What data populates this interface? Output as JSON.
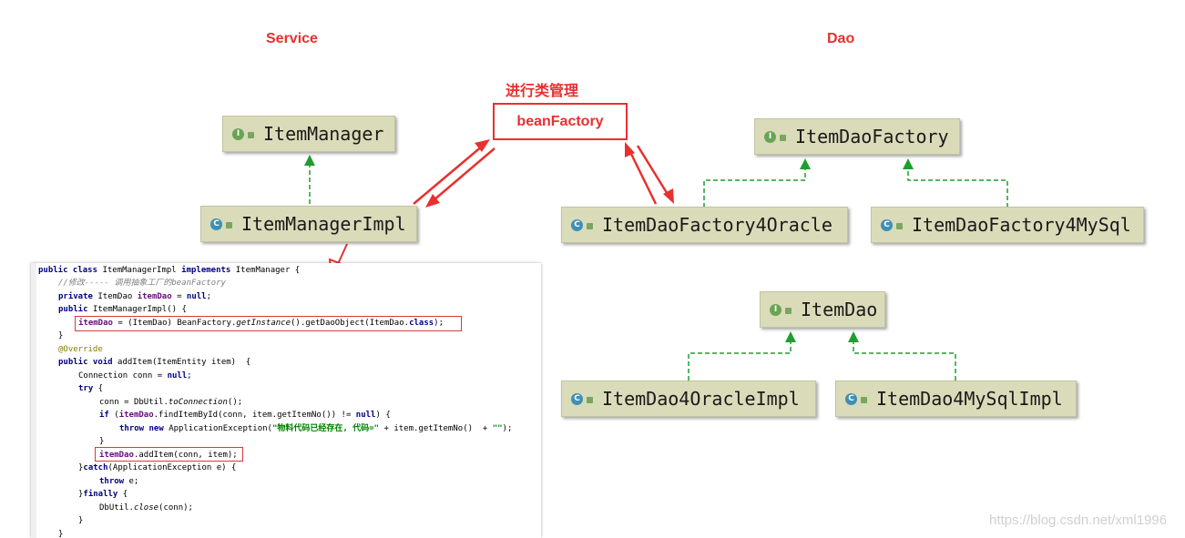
{
  "labels": {
    "service": "Service",
    "dao": "Dao",
    "manage": "进行类管理",
    "bean_factory": "beanFactory"
  },
  "classes": {
    "item_manager": "ItemManager",
    "item_manager_impl": "ItemManagerImpl",
    "item_dao_factory": "ItemDaoFactory",
    "item_dao_factory_oracle": "ItemDaoFactory4Oracle",
    "item_dao_factory_mysql": "ItemDaoFactory4MySql",
    "item_dao": "ItemDao",
    "item_dao_oracle_impl": "ItemDao4OracleImpl",
    "item_dao_mysql_impl": "ItemDao4MySqlImpl"
  },
  "badges": {
    "interface": "I",
    "class": "C"
  },
  "code": {
    "l1": [
      "public class ",
      "ItemManagerImpl ",
      "implements ",
      "ItemManager {"
    ],
    "l2": "//修改----- 调用抽象工厂的beanFactory",
    "l3": [
      "private ",
      "ItemDao ",
      "itemDao",
      " = ",
      "null",
      ";"
    ],
    "l4": [
      "public ",
      "ItemManagerImpl() {"
    ],
    "l5": [
      "itemDao",
      " = (ItemDao) BeanFactory.",
      "getInstance",
      "().getDaoObject(ItemDao.",
      "class",
      ");"
    ],
    "l6": "}",
    "l7": "@Override",
    "l8": [
      "public void ",
      "addItem(ItemEntity item)  {"
    ],
    "l9": [
      "Connection ",
      "conn",
      " = ",
      "null",
      ";"
    ],
    "l10": [
      "try",
      " {"
    ],
    "l11": [
      "conn",
      " = DbUtil.",
      "toConnection",
      "();"
    ],
    "l12": [
      "if ",
      "(",
      "itemDao",
      ".findItemById(conn, item.getItemNo()) != ",
      "null",
      ") {"
    ],
    "l13": [
      "throw new ",
      "ApplicationException(",
      "\"物料代码已经存在, 代码=\"",
      " + item.getItemNo()  + ",
      "\"\"",
      ");"
    ],
    "l14": "}",
    "l15": [
      "itemDao",
      ".addItem(conn, item);"
    ],
    "l16": [
      "}",
      "catch",
      "(ApplicationException ",
      "e",
      ") {"
    ],
    "l17": [
      "throw ",
      "e;"
    ],
    "l18": [
      "}",
      "finally",
      " {"
    ],
    "l19": [
      "DbUtil.",
      "close",
      "(conn);"
    ],
    "l20": "}",
    "l21": "}"
  },
  "watermark": "https://blog.csdn.net/xml1996",
  "colors": {
    "accent": "#e8302f",
    "uml_box": "#dadbb9",
    "uml_arrow": "#1f9e2f"
  }
}
